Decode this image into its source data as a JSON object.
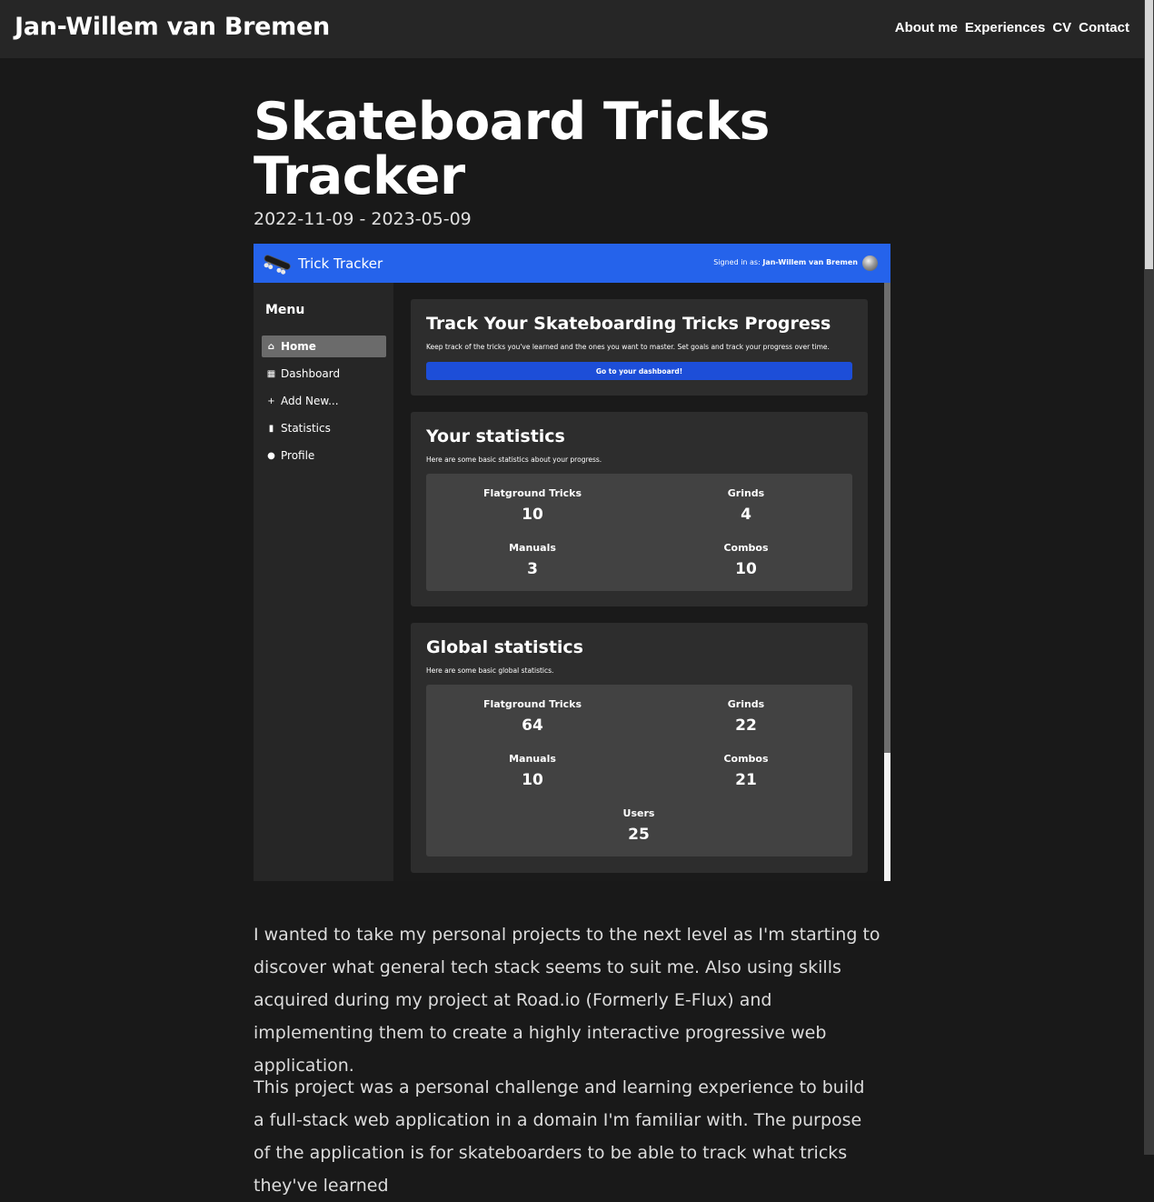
{
  "site": {
    "title": "Jan-Willem van Bremen",
    "nav": [
      "About me",
      "Experiences",
      "CV",
      "Contact"
    ]
  },
  "article": {
    "title_line1": "Skateboard Tricks",
    "title_line2": "Tracker",
    "dates": "2022-11-09 - 2023-05-09",
    "paragraphs": [
      "I wanted to take my personal projects to the next level as I'm starting to discover what general tech stack seems to suit me. Also using skills acquired during my project at Road.io (Formerly E-Flux) and implementing them to create a highly interactive progressive web application.",
      "This project was a personal challenge and learning experience to build a full-stack web application in a domain I'm familiar with. The purpose of the application is for skateboarders to be able to track what tricks they've learned"
    ]
  },
  "screenshot": {
    "app_title": "Trick Tracker",
    "signed_in_prefix": "Signed in as:",
    "signed_in_user": "Jan-Willem van Bremen",
    "menu_title": "Menu",
    "menu_items": [
      {
        "label": "Home",
        "icon": "home-icon",
        "active": true
      },
      {
        "label": "Dashboard",
        "icon": "grid-icon",
        "active": false
      },
      {
        "label": "Add New...",
        "icon": "plus-icon",
        "active": false
      },
      {
        "label": "Statistics",
        "icon": "bar-chart-icon",
        "active": false
      },
      {
        "label": "Profile",
        "icon": "person-icon",
        "active": false
      }
    ],
    "hero": {
      "title": "Track Your Skateboarding Tricks Progress",
      "description": "Keep track of the tricks you've learned and the ones you want to master. Set goals and track your progress over time.",
      "button": "Go to your dashboard!"
    },
    "your_stats": {
      "title": "Your statistics",
      "description": "Here are some basic statistics about your progress.",
      "items": [
        {
          "label": "Flatground Tricks",
          "value": "10"
        },
        {
          "label": "Grinds",
          "value": "4"
        },
        {
          "label": "Manuals",
          "value": "3"
        },
        {
          "label": "Combos",
          "value": "10"
        }
      ]
    },
    "global_stats": {
      "title": "Global statistics",
      "description": "Here are some basic global statistics.",
      "items": [
        {
          "label": "Flatground Tricks",
          "value": "64"
        },
        {
          "label": "Grinds",
          "value": "22"
        },
        {
          "label": "Manuals",
          "value": "10"
        },
        {
          "label": "Combos",
          "value": "21"
        },
        {
          "label": "Users",
          "value": "25"
        }
      ]
    }
  }
}
